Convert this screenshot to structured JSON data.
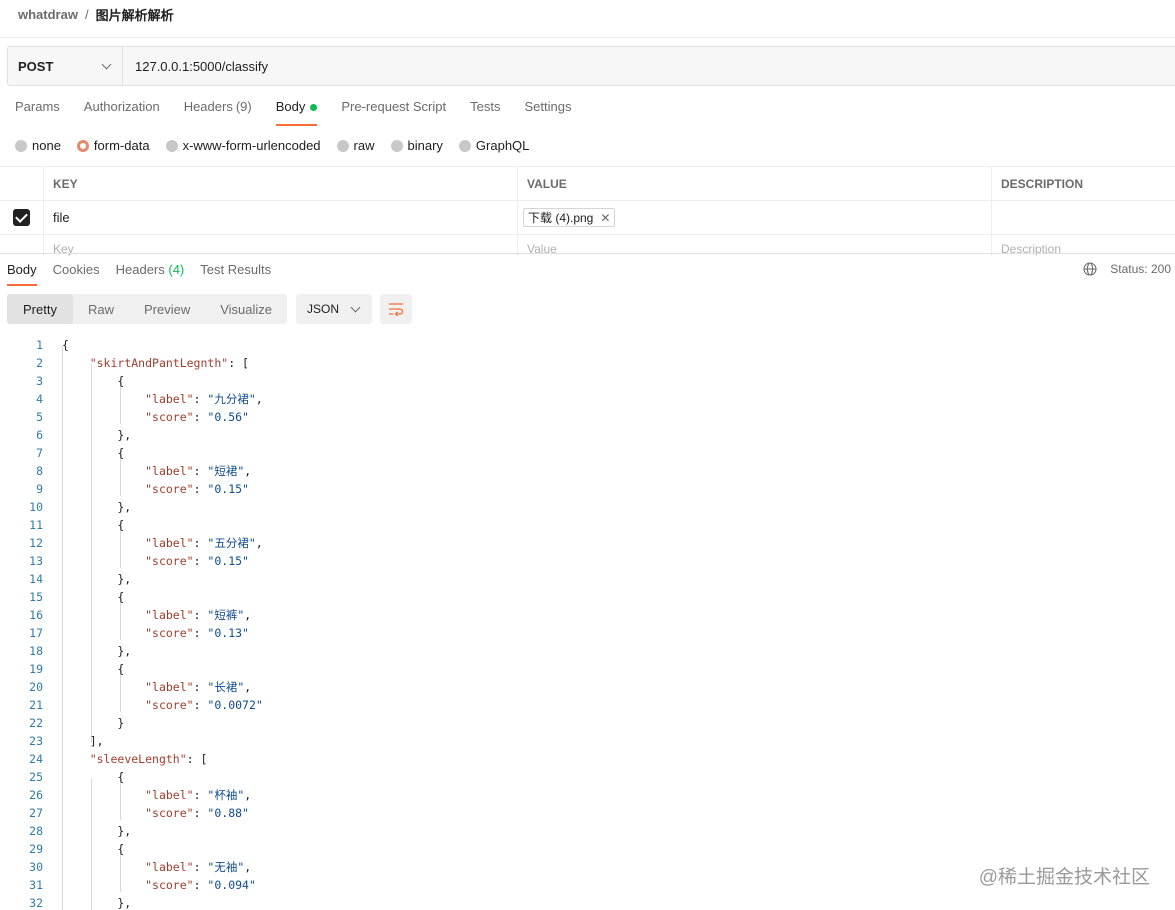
{
  "breadcrumb": {
    "workspace": "whatdraw",
    "separator": "/",
    "request": "图片解析解析"
  },
  "request": {
    "method": "POST",
    "url": "127.0.0.1:5000/classify"
  },
  "request_tabs": [
    {
      "label": "Params",
      "count": ""
    },
    {
      "label": "Authorization",
      "count": ""
    },
    {
      "label": "Headers",
      "count": "(9)"
    },
    {
      "label": "Body",
      "count": "",
      "active": true
    },
    {
      "label": "Pre-request Script",
      "count": ""
    },
    {
      "label": "Tests",
      "count": ""
    },
    {
      "label": "Settings",
      "count": ""
    }
  ],
  "body_types": [
    "none",
    "form-data",
    "x-www-form-urlencoded",
    "raw",
    "binary",
    "GraphQL"
  ],
  "body_type_selected": "form-data",
  "params_table": {
    "headers": [
      "KEY",
      "VALUE",
      "DESCRIPTION"
    ],
    "rows": [
      {
        "key": "file",
        "value": "下载 (4).png",
        "description": ""
      }
    ],
    "placeholders": {
      "key": "Key",
      "value": "Value",
      "description": "Description"
    }
  },
  "response_tabs": [
    {
      "label": "Body",
      "count": ""
    },
    {
      "label": "Cookies",
      "count": ""
    },
    {
      "label": "Headers",
      "count": "(4)"
    },
    {
      "label": "Test Results",
      "count": ""
    }
  ],
  "status": "Status: 200",
  "formats": [
    "Pretty",
    "Raw",
    "Preview",
    "Visualize"
  ],
  "format_selected": "Pretty",
  "language": "JSON",
  "code_lines": [
    [
      "{"
    ],
    [
      "    ",
      "k:\"skirtAndPantLegnth\"",
      ": ["
    ],
    [
      "        {"
    ],
    [
      "            ",
      "k:\"label\"",
      ": ",
      "s:\"九分裙\"",
      ","
    ],
    [
      "            ",
      "k:\"score\"",
      ": ",
      "s:\"0.56\""
    ],
    [
      "        },"
    ],
    [
      "        {"
    ],
    [
      "            ",
      "k:\"label\"",
      ": ",
      "s:\"短裙\"",
      ","
    ],
    [
      "            ",
      "k:\"score\"",
      ": ",
      "s:\"0.15\""
    ],
    [
      "        },"
    ],
    [
      "        {"
    ],
    [
      "            ",
      "k:\"label\"",
      ": ",
      "s:\"五分裙\"",
      ","
    ],
    [
      "            ",
      "k:\"score\"",
      ": ",
      "s:\"0.15\""
    ],
    [
      "        },"
    ],
    [
      "        {"
    ],
    [
      "            ",
      "k:\"label\"",
      ": ",
      "s:\"短裤\"",
      ","
    ],
    [
      "            ",
      "k:\"score\"",
      ": ",
      "s:\"0.13\""
    ],
    [
      "        },"
    ],
    [
      "        {"
    ],
    [
      "            ",
      "k:\"label\"",
      ": ",
      "s:\"长裙\"",
      ","
    ],
    [
      "            ",
      "k:\"score\"",
      ": ",
      "s:\"0.0072\""
    ],
    [
      "        }"
    ],
    [
      "    ],"
    ],
    [
      "    ",
      "k:\"sleeveLength\"",
      ": ["
    ],
    [
      "        {"
    ],
    [
      "            ",
      "k:\"label\"",
      ": ",
      "s:\"杯袖\"",
      ","
    ],
    [
      "            ",
      "k:\"score\"",
      ": ",
      "s:\"0.88\""
    ],
    [
      "        },"
    ],
    [
      "        {"
    ],
    [
      "            ",
      "k:\"label\"",
      ": ",
      "s:\"无袖\"",
      ","
    ],
    [
      "            ",
      "k:\"score\"",
      ": ",
      "s:\"0.094\""
    ],
    [
      "        },"
    ]
  ],
  "watermark": "@稀土掘金技术社区",
  "colors": {
    "accent": "#ff6c37",
    "active_dot": "#0cbb52",
    "json_key": "#a13d2d",
    "json_string": "#0f4c8d",
    "line_number": "#2f7aa8"
  },
  "icons": {
    "method_dropdown": "chevron-down-icon",
    "checkbox": "checkbox-checked-icon",
    "file_remove": "close-icon",
    "status_globe": "globe-icon",
    "wrap": "wrap-lines-icon"
  }
}
